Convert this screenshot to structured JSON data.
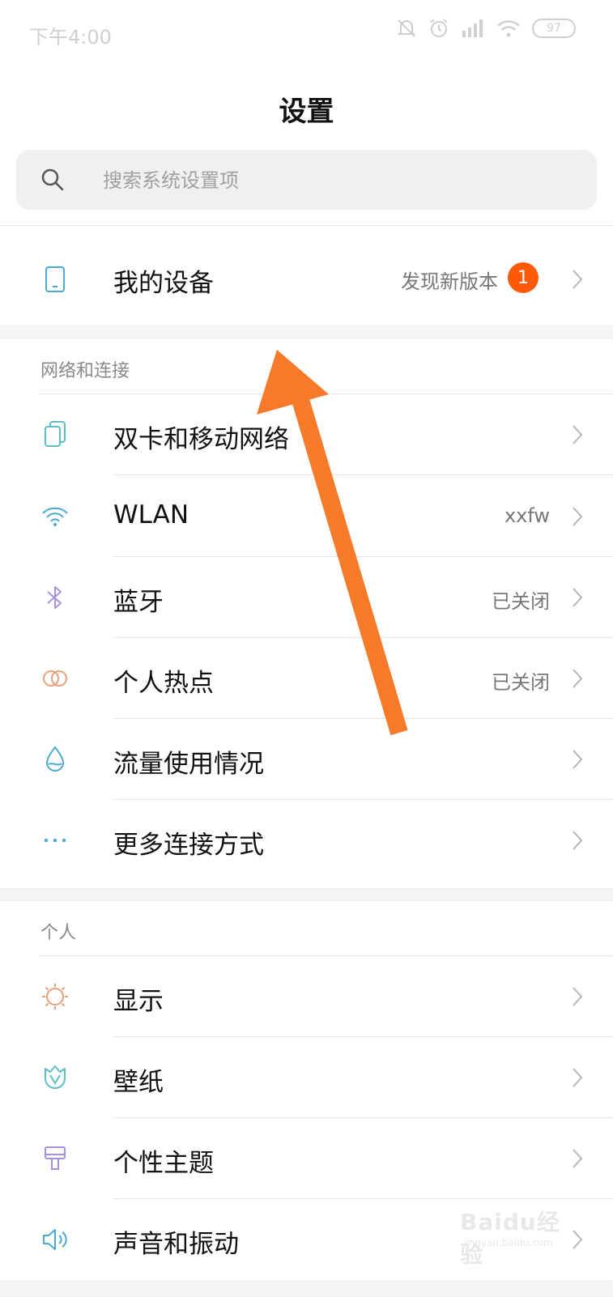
{
  "status_bar": {
    "time": "下午4:00",
    "battery": "97"
  },
  "title": "设置",
  "search": {
    "placeholder": "搜索系统设置项"
  },
  "my_device": {
    "label": "我的设备",
    "value": "发现新版本",
    "badge": "1"
  },
  "sections": [
    {
      "header": "网络和连接",
      "items": [
        {
          "label": "双卡和移动网络",
          "value": "",
          "icon": "sim-cards-icon",
          "color": "#5bbfc6"
        },
        {
          "label": "WLAN",
          "value": "xxfw",
          "icon": "wifi-icon",
          "color": "#4aa9d6"
        },
        {
          "label": "蓝牙",
          "value": "已关闭",
          "icon": "bluetooth-icon",
          "color": "#a88fe0"
        },
        {
          "label": "个人热点",
          "value": "已关闭",
          "icon": "hotspot-icon",
          "color": "#e8a27a"
        },
        {
          "label": "流量使用情况",
          "value": "",
          "icon": "data-usage-icon",
          "color": "#4aa9d6"
        },
        {
          "label": "更多连接方式",
          "value": "",
          "icon": "more-dots-icon",
          "color": "#4aa9d6"
        }
      ]
    },
    {
      "header": "个人",
      "items": [
        {
          "label": "显示",
          "value": "",
          "icon": "display-sun-icon",
          "color": "#e8a27a"
        },
        {
          "label": "壁纸",
          "value": "",
          "icon": "wallpaper-tulip-icon",
          "color": "#5bbfc6"
        },
        {
          "label": "个性主题",
          "value": "",
          "icon": "theme-brush-icon",
          "color": "#a88fe0"
        },
        {
          "label": "声音和振动",
          "value": "",
          "icon": "sound-icon",
          "color": "#4aa9d6"
        }
      ]
    }
  ],
  "annotation": {
    "color": "#f57a2a"
  },
  "watermark": {
    "main": "Baidu经验",
    "sub": "jingyan.baidu.com"
  }
}
